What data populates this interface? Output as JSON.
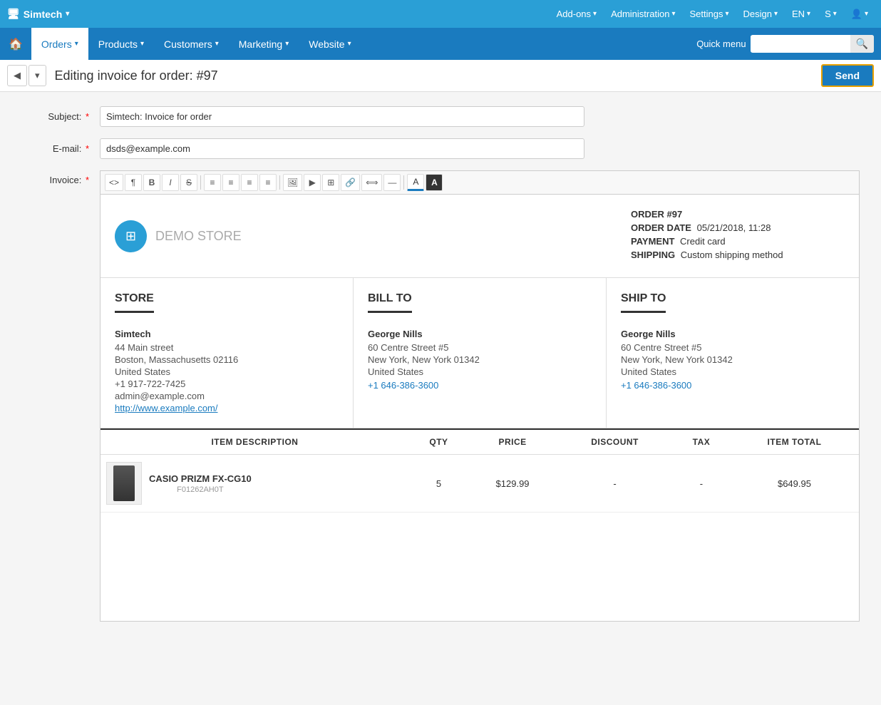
{
  "topbar": {
    "logo": "Simtech",
    "logo_icon": "🖥",
    "nav_items": [
      {
        "label": "Add-ons",
        "has_dropdown": true
      },
      {
        "label": "Administration",
        "has_dropdown": true
      },
      {
        "label": "Settings",
        "has_dropdown": true
      },
      {
        "label": "Design",
        "has_dropdown": true
      },
      {
        "label": "EN",
        "has_dropdown": true
      },
      {
        "label": "S",
        "has_dropdown": true
      },
      {
        "label": "👤",
        "has_dropdown": true
      }
    ]
  },
  "secondbar": {
    "home_icon": "🏠",
    "items": [
      {
        "label": "Orders",
        "active": true,
        "has_dropdown": true
      },
      {
        "label": "Products",
        "has_dropdown": true
      },
      {
        "label": "Customers",
        "has_dropdown": true
      },
      {
        "label": "Marketing",
        "has_dropdown": true
      },
      {
        "label": "Website",
        "has_dropdown": true
      }
    ],
    "quick_menu_label": "Quick menu",
    "search_placeholder": ""
  },
  "page_header": {
    "title": "Editing invoice for order: #97",
    "send_button": "Send"
  },
  "form": {
    "subject_label": "Subject:",
    "subject_value": "Simtech: Invoice for order",
    "subject_placeholder": "Simtech: Invoice for order",
    "email_label": "E-mail:",
    "email_value": "dsds@example.com",
    "email_placeholder": "dsds@example.com",
    "invoice_label": "Invoice:"
  },
  "toolbar": {
    "buttons": [
      {
        "label": "<>",
        "title": "Source"
      },
      {
        "label": "¶",
        "title": "Paragraph"
      },
      {
        "label": "B",
        "title": "Bold"
      },
      {
        "label": "I",
        "title": "Italic"
      },
      {
        "label": "S",
        "title": "Strikethrough"
      },
      {
        "label": "≡",
        "title": "Unordered List"
      },
      {
        "label": "≡",
        "title": "Ordered List"
      },
      {
        "label": "≡",
        "title": "Outdent"
      },
      {
        "label": "≡",
        "title": "Indent"
      },
      {
        "label": "🖼",
        "title": "Image"
      },
      {
        "label": "▶",
        "title": "Video"
      },
      {
        "label": "⊞",
        "title": "Table"
      },
      {
        "label": "🔗",
        "title": "Link"
      },
      {
        "label": "⟺",
        "title": "Align"
      },
      {
        "label": "—",
        "title": "Horizontal Rule"
      },
      {
        "label": "A",
        "title": "Font Color"
      },
      {
        "label": "A",
        "title": "Background Color"
      }
    ]
  },
  "invoice": {
    "store_name": "DEMO",
    "store_suffix": " STORE",
    "logo_icon": "⊞",
    "order_number": "ORDER #97",
    "order_date_label": "ORDER DATE",
    "order_date_value": "05/21/2018, 11:28",
    "payment_label": "PAYMENT",
    "payment_value": "Credit card",
    "shipping_label": "SHIPPING",
    "shipping_value": "Custom shipping method",
    "store_section": {
      "title": "STORE",
      "name": "Simtech",
      "address1": "44 Main street",
      "address2": "Boston, Massachusetts 02116",
      "country": "United States",
      "phone": "+1 917-722-7425",
      "email": "admin@example.com",
      "website": "http://www.example.com/"
    },
    "bill_to": {
      "title": "BILL TO",
      "name": "George Nills",
      "address1": "60 Centre Street #5",
      "address2": "New York, New York 01342",
      "country": "United States",
      "phone": "+1 646-386-3600"
    },
    "ship_to": {
      "title": "SHIP TO",
      "name": "George Nills",
      "address1": "60 Centre Street #5",
      "address2": "New York, New York 01342",
      "country": "United States",
      "phone": "+1 646-386-3600"
    },
    "table": {
      "headers": [
        "ITEM DESCRIPTION",
        "QTY",
        "PRICE",
        "DISCOUNT",
        "TAX",
        "ITEM TOTAL"
      ],
      "rows": [
        {
          "name": "CASIO PRIZM FX-CG10",
          "sku": "F01262AH0T",
          "qty": "5",
          "price": "$129.99",
          "discount": "-",
          "tax": "-",
          "total": "$649.95"
        }
      ]
    }
  }
}
